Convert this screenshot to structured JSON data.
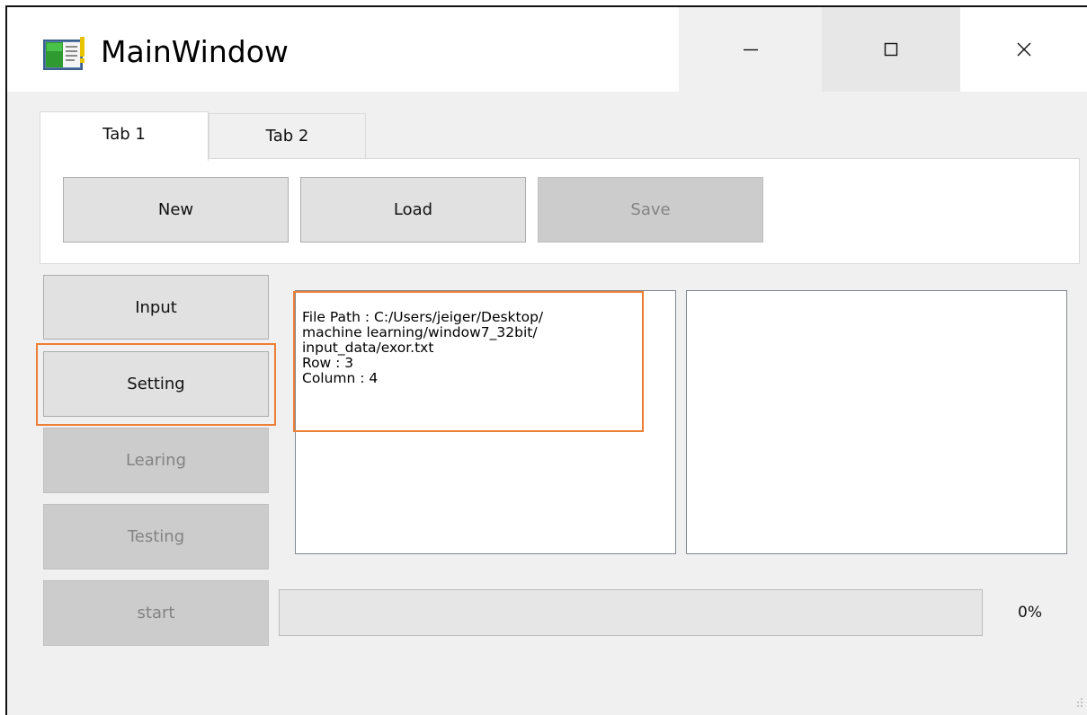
{
  "window": {
    "title": "MainWindow",
    "icon": "app-window-icon",
    "controls": [
      "minimize-icon",
      "maximize-icon",
      "close-icon"
    ]
  },
  "tabs": [
    {
      "label": "Tab 1",
      "selected": true
    },
    {
      "label": "Tab 2",
      "selected": false
    }
  ],
  "toolbar": {
    "new_label": "New",
    "load_label": "Load",
    "save_label": "Save"
  },
  "sidebar": {
    "input_label": "Input",
    "setting_label": "Setting",
    "learning_label": "Learing",
    "testing_label": "Testing",
    "start_label": "start"
  },
  "info": {
    "lines": [
      "File Path : C:/Users/jeiger/Desktop/",
      "machine learning/window7_32bit/",
      "input_data/exor.txt",
      "Row : 3",
      "Column : 4"
    ]
  },
  "progress": {
    "value": 0,
    "text": "0%"
  },
  "colors": {
    "highlight": "#ec7f33",
    "disabled_bg": "#cccccc",
    "button_bg": "#e1e1e1"
  }
}
